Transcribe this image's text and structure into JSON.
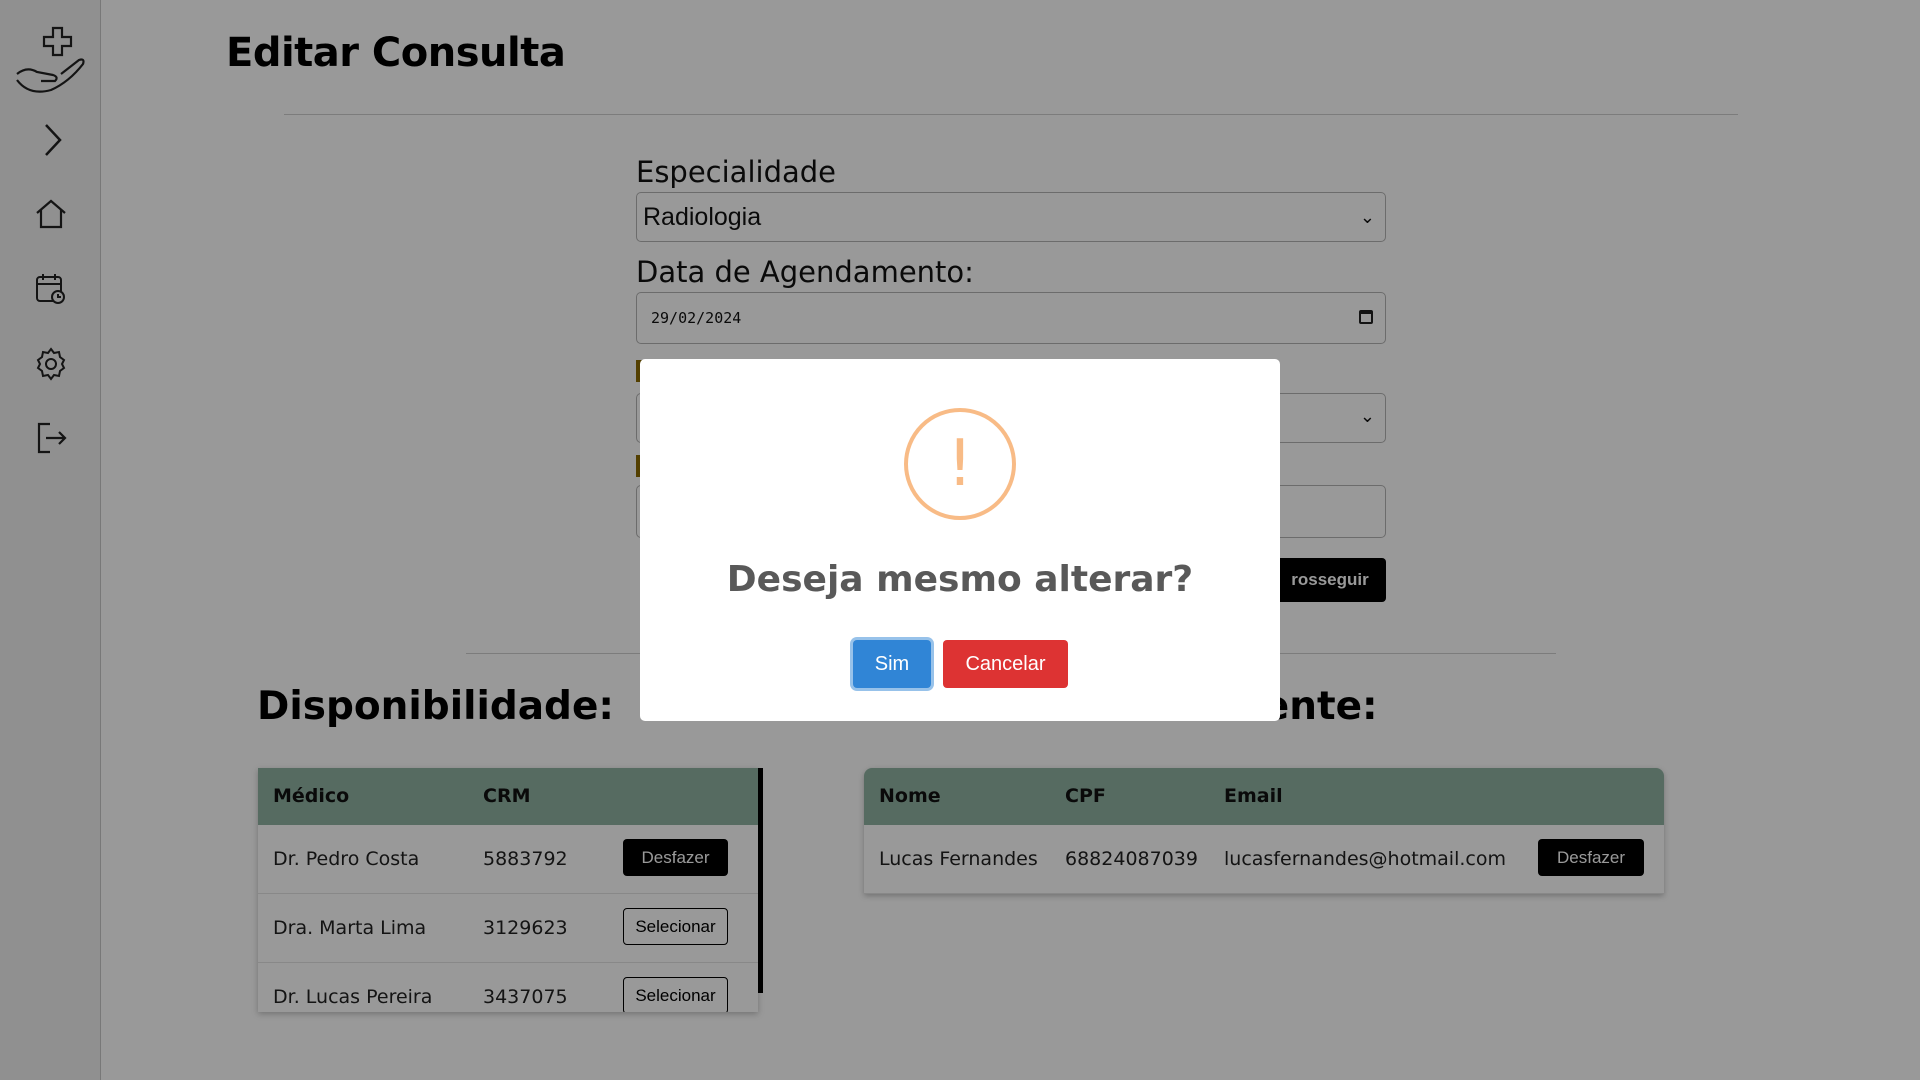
{
  "sidebar": {
    "icons": [
      "hand-cross-logo-icon",
      "chevron-right-icon",
      "home-icon",
      "calendar-clock-icon",
      "gear-icon",
      "logout-icon"
    ]
  },
  "page": {
    "title": "Editar Consulta"
  },
  "form": {
    "especialidade_label": "Especialidade",
    "especialidade_value": "Radiologia",
    "data_label": "Data de Agendamento:",
    "data_value": "29/02/2024",
    "proceed_label": "rosseguir"
  },
  "availability": {
    "title": "Disponibilidade:",
    "headers": [
      "Médico",
      "CRM"
    ],
    "rows": [
      {
        "name": "Dr. Pedro Costa",
        "crm": "5883792",
        "action": "Desfazer"
      },
      {
        "name": "Dra. Marta Lima",
        "crm": "3129623",
        "action": "Selecionar"
      },
      {
        "name": "Dr. Lucas Pereira",
        "crm": "3437075",
        "action": "Selecionar"
      }
    ]
  },
  "patients": {
    "title": "Selecione um Paciente:",
    "headers": [
      "Nome",
      "CPF",
      "Email"
    ],
    "rows": [
      {
        "name": "Lucas Fernandes",
        "cpf": "68824087039",
        "email": "lucasfernandes@hotmail.com",
        "action": "Desfazer"
      }
    ]
  },
  "modal": {
    "icon": "warning-icon",
    "icon_symbol": "!",
    "title": "Deseja mesmo alterar?",
    "confirm_label": "Sim",
    "cancel_label": "Cancelar"
  },
  "colors": {
    "table_header": "#8fb2a2",
    "warning": "#f8bb86",
    "confirm": "#3085d6",
    "cancel": "#dd3333"
  }
}
